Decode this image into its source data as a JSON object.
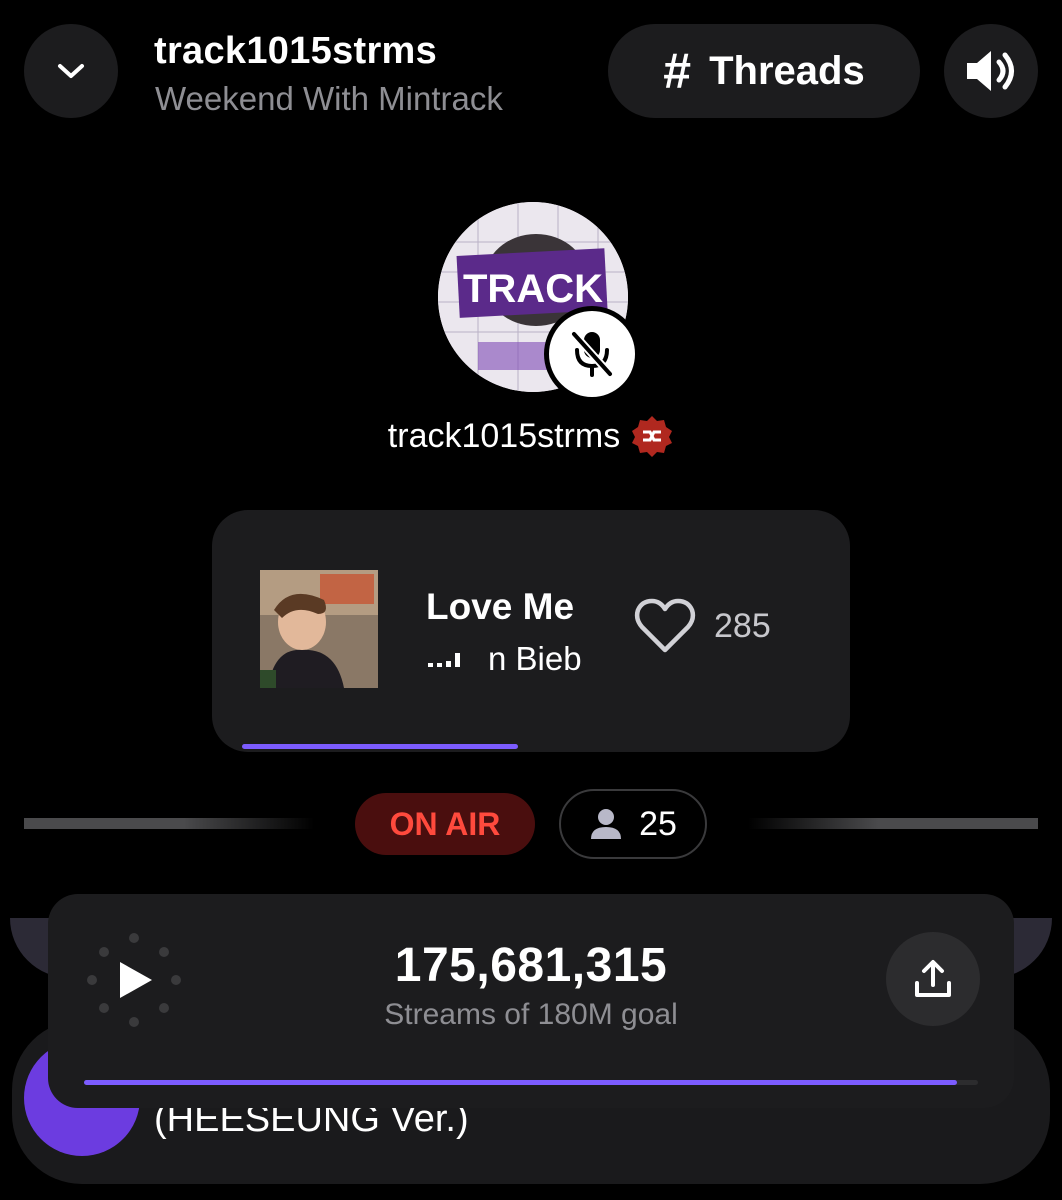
{
  "header": {
    "station_name": "track1015strms",
    "show_name": "Weekend With Mintrack",
    "threads_label": "Threads",
    "threads_icon": "#"
  },
  "host": {
    "username": "track1015strms",
    "avatar_text": "TRACK",
    "mic_state": "muted"
  },
  "now_playing": {
    "title": "Love Me",
    "artist_visible": "n Bieb",
    "likes": "285",
    "progress": 0.45
  },
  "live": {
    "status": "ON AIR",
    "listeners": "25"
  },
  "stream_goal": {
    "count": "175,681,315",
    "goal_text": "Streams of 180M goal",
    "progress": 0.976
  },
  "background_card": {
    "track_text": "(HEESEUNG Ver.)"
  },
  "colors": {
    "accent": "#7c5cff",
    "on_air_text": "#ff4a3d",
    "on_air_bg": "#4a0e0e",
    "card_bg": "#1c1c1e"
  }
}
